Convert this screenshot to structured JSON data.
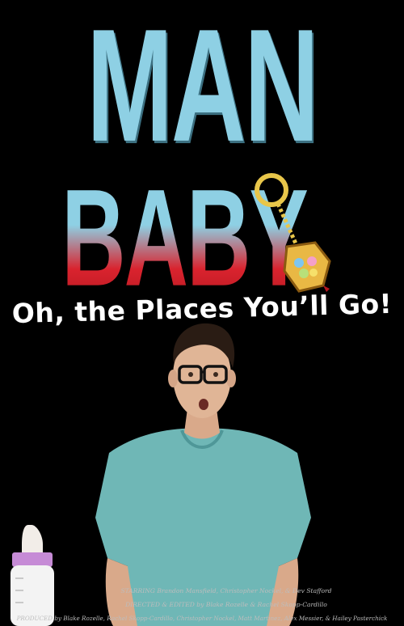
{
  "poster": {
    "title_line1": "MAN",
    "title_line2": "BABY",
    "subtitle": "Oh, the Places You’ll Go!",
    "credits": {
      "starring": "STARRING Brandon Mansfield, Christopher Nockel, & Dev Stafford",
      "directed": "DIRECTED & EDITED by Blake Rozelle & Rachel Skopp-Cardillo",
      "produced": "PRODUCED by Blake Rozelle, Rachel Skopp-Cardillo, Christopher Nockel, Matt Martinez, Alex Messier, & Hailey Pasterchick"
    }
  },
  "colors": {
    "background": "#000000",
    "title_blue": "#8ed0e4",
    "title_red": "#d9232e",
    "shirt": "#6fb7b6",
    "subtitle": "#ffffff"
  },
  "icons": {
    "rattle": "baby-rattle-icon",
    "bottle": "baby-bottle-icon"
  }
}
